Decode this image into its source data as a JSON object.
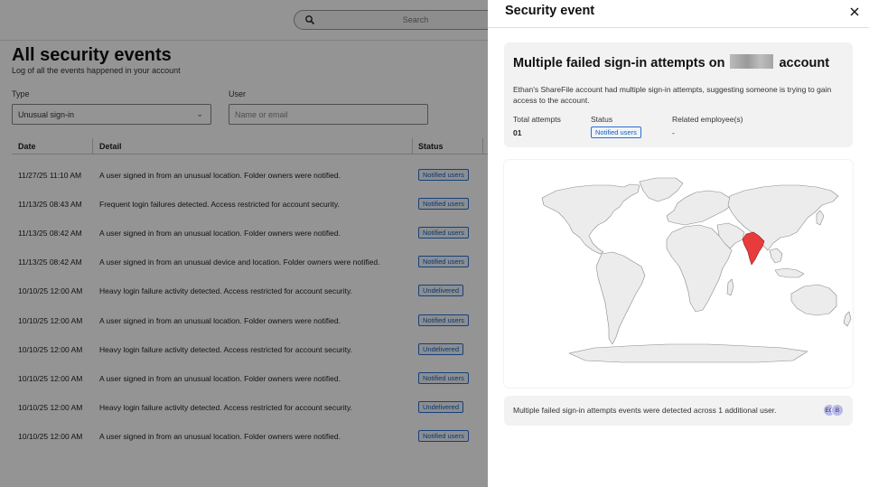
{
  "search": {
    "placeholder": "Search"
  },
  "page": {
    "title": "All security events",
    "subtitle": "Log of all the events happened in your account"
  },
  "filters": {
    "type_label": "Type",
    "type_value": "Unusual sign-in",
    "user_label": "User",
    "user_placeholder": "Name or email"
  },
  "table": {
    "headers": [
      "Date",
      "Detail",
      "Status"
    ],
    "rows": [
      {
        "date": "11/27/25 11:10 AM",
        "detail": "A user signed in from an unusual location. Folder owners were notified.",
        "status": "Notified users"
      },
      {
        "date": "11/13/25 08:43 AM",
        "detail": "Frequent login failures detected. Access restricted for account security.",
        "status": "Notified users"
      },
      {
        "date": "11/13/25 08:42 AM",
        "detail": "A user signed in from an unusual location. Folder owners were notified.",
        "status": "Notified users"
      },
      {
        "date": "11/13/25 08:42 AM",
        "detail": "A user signed in from an unusual device and location. Folder owners were notified.",
        "status": "Notified users"
      },
      {
        "date": "10/10/25 12:00 AM",
        "detail": "Heavy login failure activity detected. Access restricted for account security.",
        "status": "Undelivered"
      },
      {
        "date": "10/10/25 12:00 AM",
        "detail": "A user signed in from an unusual location. Folder owners were notified.",
        "status": "Notified users"
      },
      {
        "date": "10/10/25 12:00 AM",
        "detail": "Heavy login failure activity detected. Access restricted for account security.",
        "status": "Undelivered"
      },
      {
        "date": "10/10/25 12:00 AM",
        "detail": "A user signed in from an unusual location. Folder owners were notified.",
        "status": "Notified users"
      },
      {
        "date": "10/10/25 12:00 AM",
        "detail": "Heavy login failure activity detected. Access restricted for account security.",
        "status": "Undelivered"
      },
      {
        "date": "10/10/25 12:00 AM",
        "detail": "A user signed in from an unusual location. Folder owners were notified.",
        "status": "Notified users"
      }
    ]
  },
  "panel": {
    "title": "Security event",
    "heading_prefix": "Multiple failed sign-in attempts on",
    "heading_suffix": "account",
    "description": "Ethan's ShareFile account had multiple sign-in attempts, suggesting someone is trying to gain access to the account.",
    "metrics": {
      "total_label": "Total attempts",
      "total_value": "01",
      "status_label": "Status",
      "status_value": "Notified users",
      "related_label": "Related employee(s)",
      "related_value": "-"
    },
    "map": {
      "highlighted_country": "India",
      "highlight_color": "#e83c3c",
      "land_color": "#ececec"
    },
    "footer_message": "Multiple failed sign-in attempts events were detected across 1 additional user.",
    "avatars": [
      "EC",
      "B"
    ]
  },
  "colors": {
    "accent": "#2a6fcf",
    "overlay": "rgba(0,0,0,0.42)"
  }
}
